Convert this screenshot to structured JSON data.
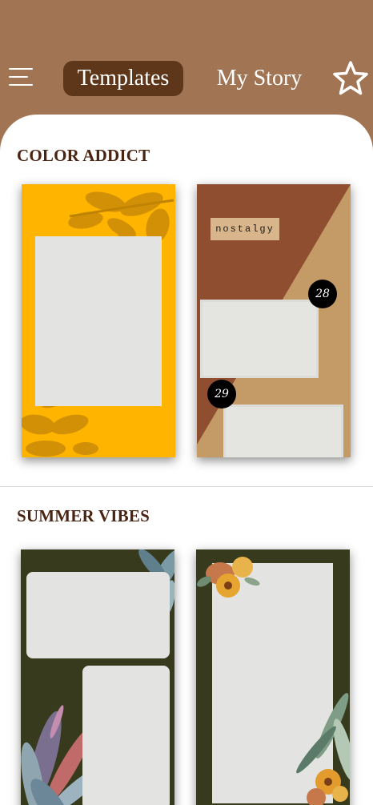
{
  "header": {
    "tabs": [
      {
        "label": "Templates",
        "active": true
      },
      {
        "label": "My Story",
        "active": false
      }
    ],
    "menu_icon": "hamburger-menu-icon",
    "favorite_icon": "star-outline-icon"
  },
  "sections": [
    {
      "title": "COLOR ADDICT",
      "templates": [
        {
          "name": "yellow-leaf-shadow"
        },
        {
          "name": "nostalgy",
          "tag": "nostalgy",
          "badges": [
            "28",
            "29"
          ]
        }
      ]
    },
    {
      "title": "SUMMER VIBES",
      "templates": [
        {
          "name": "dark-botanical-two-frames"
        },
        {
          "name": "dark-botanical-floral-frame"
        }
      ]
    }
  ],
  "colors": {
    "header_bg": "#a17454",
    "active_tab_bg": "#5e3619",
    "section_title": "#4a2412",
    "yellow": "#ffb400",
    "rust": "#8f4e2f",
    "kraft": "#c9a06c",
    "olive_dark": "#373a1c"
  }
}
